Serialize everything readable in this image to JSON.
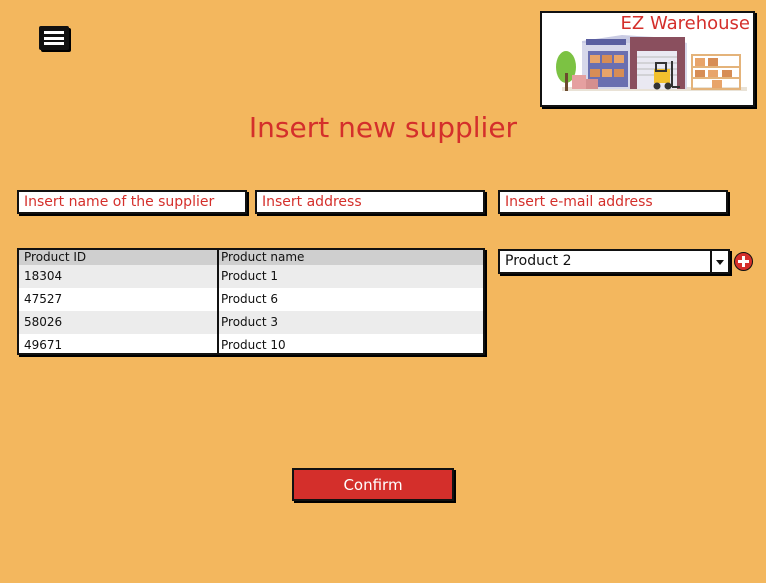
{
  "header": {
    "menu_icon": "hamburger-menu-icon",
    "logo_text": "EZ Warehouse"
  },
  "page_title": "Insert new supplier",
  "form": {
    "name_placeholder": "Insert name of the supplier",
    "address_placeholder": "Insert address",
    "email_placeholder": "Insert e-mail address"
  },
  "products_table": {
    "columns": [
      "Product ID",
      "Product name"
    ],
    "rows": [
      {
        "id": "18304",
        "name": "Product 1"
      },
      {
        "id": "47527",
        "name": "Product 6"
      },
      {
        "id": "58026",
        "name": "Product 3"
      },
      {
        "id": "49671",
        "name": "Product 10"
      }
    ]
  },
  "product_select": {
    "selected": "Product 2",
    "add_icon": "plus-circle-icon"
  },
  "confirm_label": "Confirm",
  "colors": {
    "background": "#f3b75e",
    "accent": "#d42f2b"
  }
}
